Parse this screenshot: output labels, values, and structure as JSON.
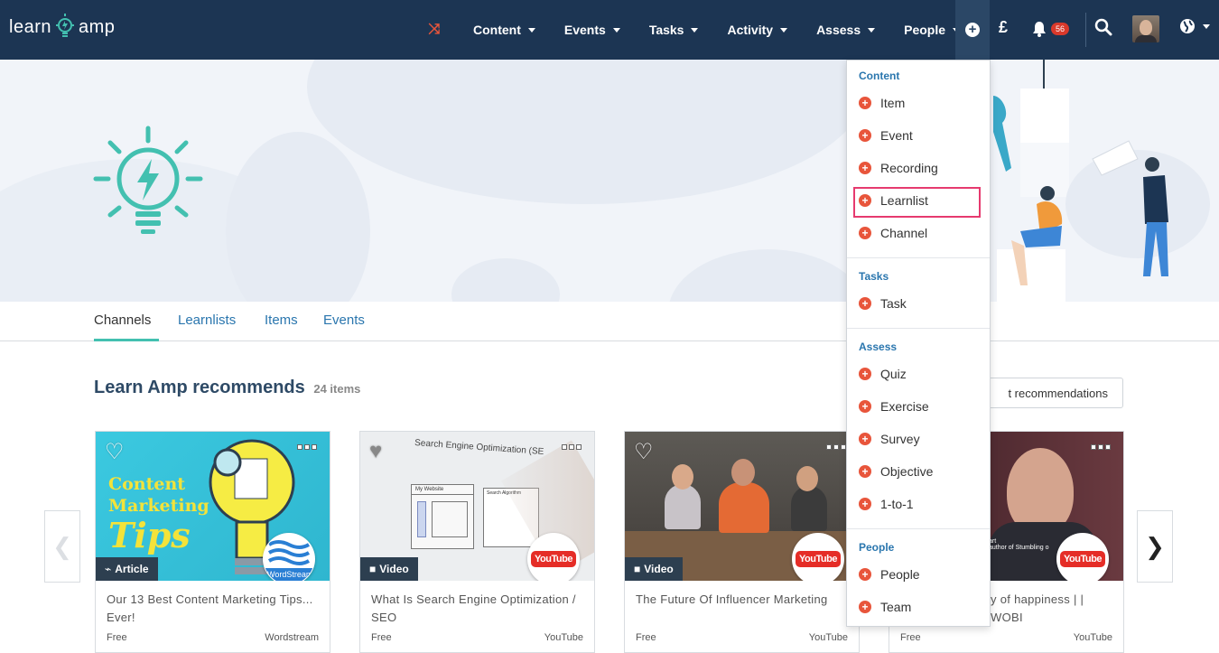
{
  "brand": {
    "left": "learn",
    "right": "amp"
  },
  "nav": {
    "items": [
      {
        "label": "Content"
      },
      {
        "label": "Events"
      },
      {
        "label": "Tasks"
      },
      {
        "label": "Activity"
      },
      {
        "label": "Assess"
      },
      {
        "label": "People"
      }
    ],
    "currency": "£",
    "notifications_count": "56"
  },
  "tabs": [
    {
      "label": "Channels"
    },
    {
      "label": "Learnlists"
    },
    {
      "label": "Items"
    },
    {
      "label": "Events"
    }
  ],
  "section": {
    "title": "Learn Amp recommends",
    "count": "24 items",
    "recommendations_button": "t recommendations"
  },
  "cards": [
    {
      "thumb_text": [
        "Content",
        "Marketing",
        "Tips"
      ],
      "type": "Article",
      "source_badge": "WordStream",
      "title": "Our 13 Best Content Marketing Tips... Ever!",
      "price": "Free",
      "source": "Wordstream"
    },
    {
      "thumb_text": [
        "Search Engine Optimization (SE",
        "My Website",
        "Search Algorithm"
      ],
      "type": "Video",
      "source_badge": "YouTube",
      "title": "What Is Search Engine Optimization / SEO",
      "price": "Free",
      "source": "YouTube"
    },
    {
      "type": "Video",
      "source_badge": "YouTube",
      "title": "The Future Of Influencer Marketing",
      "price": "Free",
      "source": "YouTube"
    },
    {
      "thumb_text": [
        "art",
        "author of Stumbling o"
      ],
      "source_badge": "YouTube",
      "title": "y of happiness | | WOBI",
      "price": "Free",
      "source": "YouTube"
    }
  ],
  "dropdown": {
    "sections": [
      {
        "heading": "Content",
        "items": [
          "Item",
          "Event",
          "Recording",
          "Learnlist",
          "Channel"
        ]
      },
      {
        "heading": "Tasks",
        "items": [
          "Task"
        ]
      },
      {
        "heading": "Assess",
        "items": [
          "Quiz",
          "Exercise",
          "Survey",
          "Objective",
          "1-to-1"
        ]
      },
      {
        "heading": "People",
        "items": [
          "People",
          "Team"
        ]
      }
    ],
    "highlighted_item": "Learnlist"
  },
  "colors": {
    "nav_bg": "#1c3553",
    "accent_teal": "#43c0b0",
    "link_blue": "#2a76ae",
    "plus_orange": "#e8553b",
    "highlight_pink": "#e63a6f"
  }
}
